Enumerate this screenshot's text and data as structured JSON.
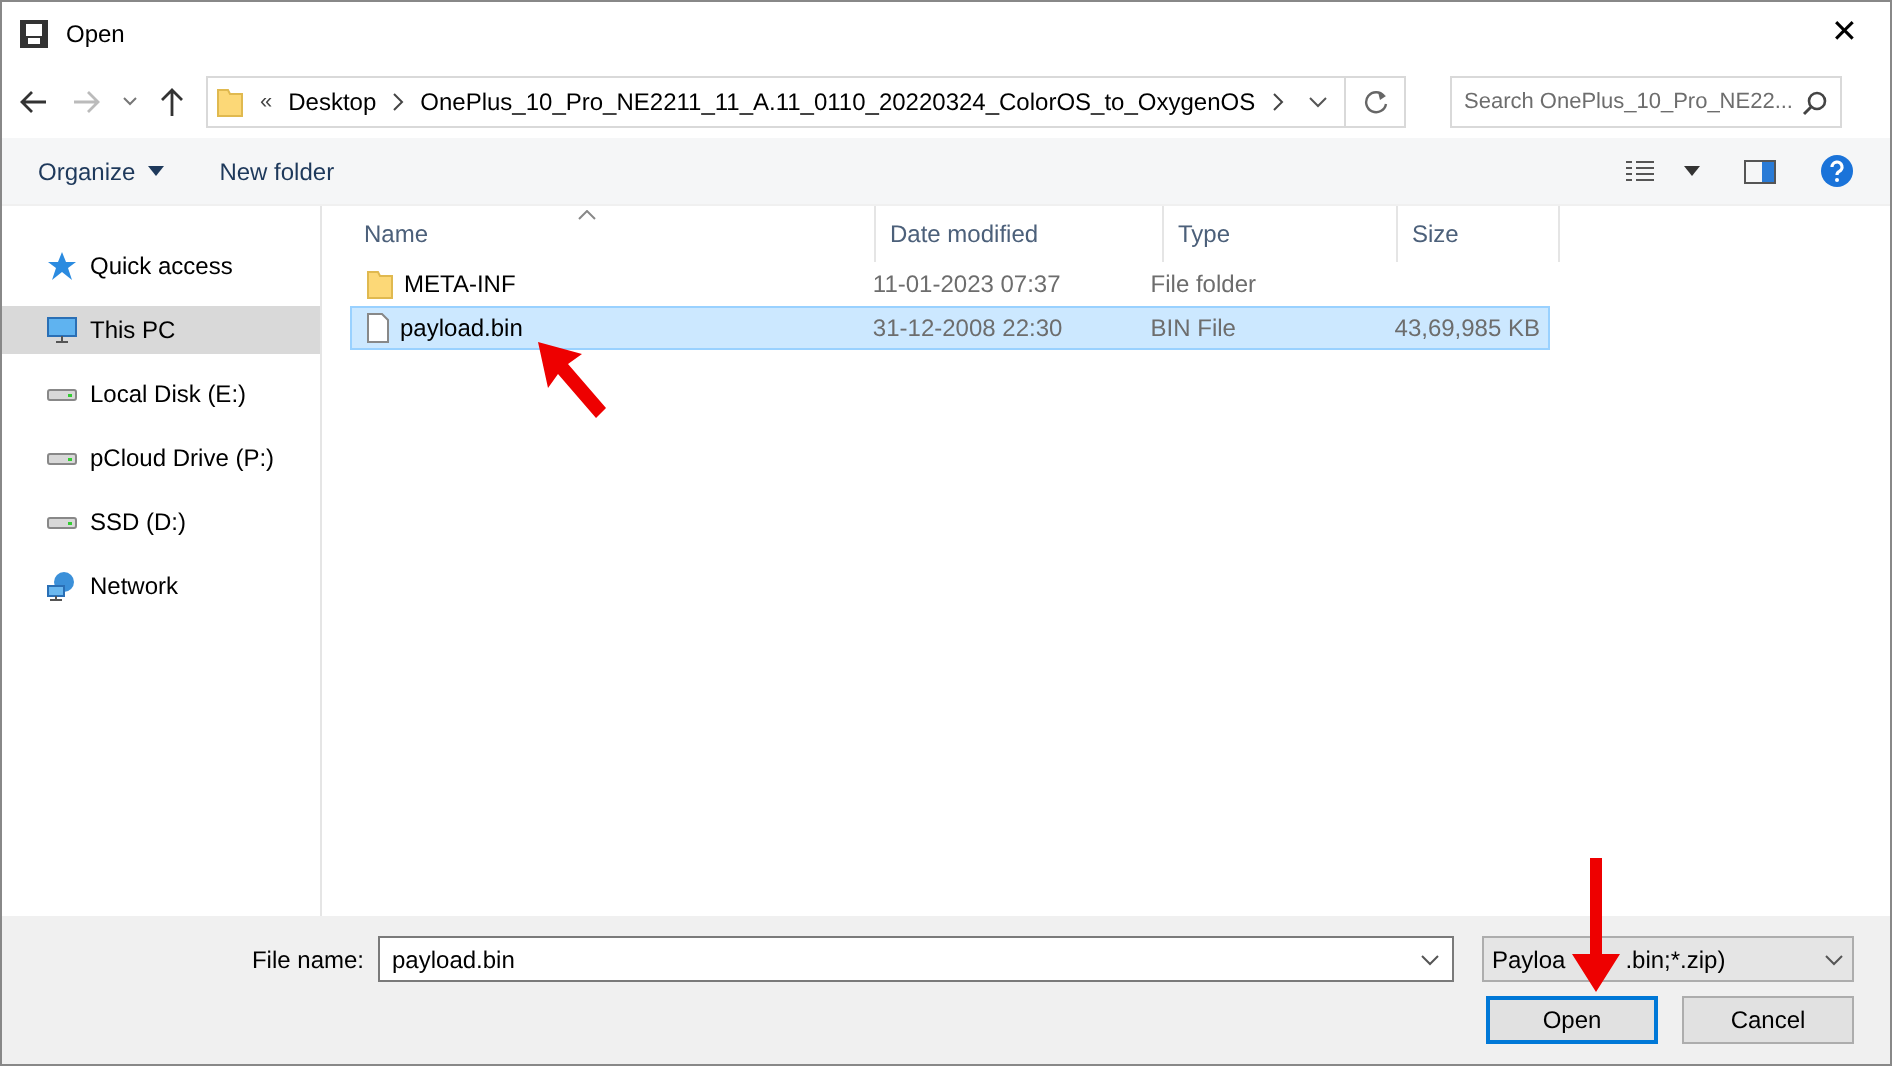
{
  "window": {
    "title": "Open",
    "close": "✕"
  },
  "address": {
    "overflow": "«",
    "crumbs": [
      "Desktop",
      "OnePlus_10_Pro_NE2211_11_A.11_0110_20220324_ColorOS_to_OxygenOS"
    ],
    "search_placeholder": "Search OnePlus_10_Pro_NE22..."
  },
  "toolbar": {
    "organize": "Organize",
    "new_folder": "New folder"
  },
  "sidebar": {
    "items": [
      {
        "label": "Quick access",
        "kind": "star",
        "selected": false
      },
      {
        "label": "This PC",
        "kind": "pc",
        "selected": true
      },
      {
        "label": "Local Disk (E:)",
        "kind": "drive",
        "selected": false
      },
      {
        "label": "pCloud Drive (P:)",
        "kind": "drive",
        "selected": false
      },
      {
        "label": "SSD (D:)",
        "kind": "drive",
        "selected": false
      },
      {
        "label": "Network",
        "kind": "network",
        "selected": false
      }
    ]
  },
  "table": {
    "columns": [
      "Name",
      "Date modified",
      "Type",
      "Size"
    ],
    "rows": [
      {
        "kind": "folder",
        "name": "META-INF",
        "date": "11-01-2023 07:37",
        "type": "File folder",
        "selected": false
      },
      {
        "kind": "file",
        "name": "payload.bin",
        "date": "31-12-2008 22:30",
        "type": "BIN File",
        "size": "43,69,985 KB",
        "selected": true
      }
    ]
  },
  "footer": {
    "file_name_label": "File name:",
    "file_name": "payload.bin",
    "filter_parts": [
      "Payloa",
      ".bin;*.zip)"
    ],
    "buttons": [
      {
        "label": "Open",
        "default": true
      },
      {
        "label": "Cancel",
        "default": false
      }
    ]
  }
}
